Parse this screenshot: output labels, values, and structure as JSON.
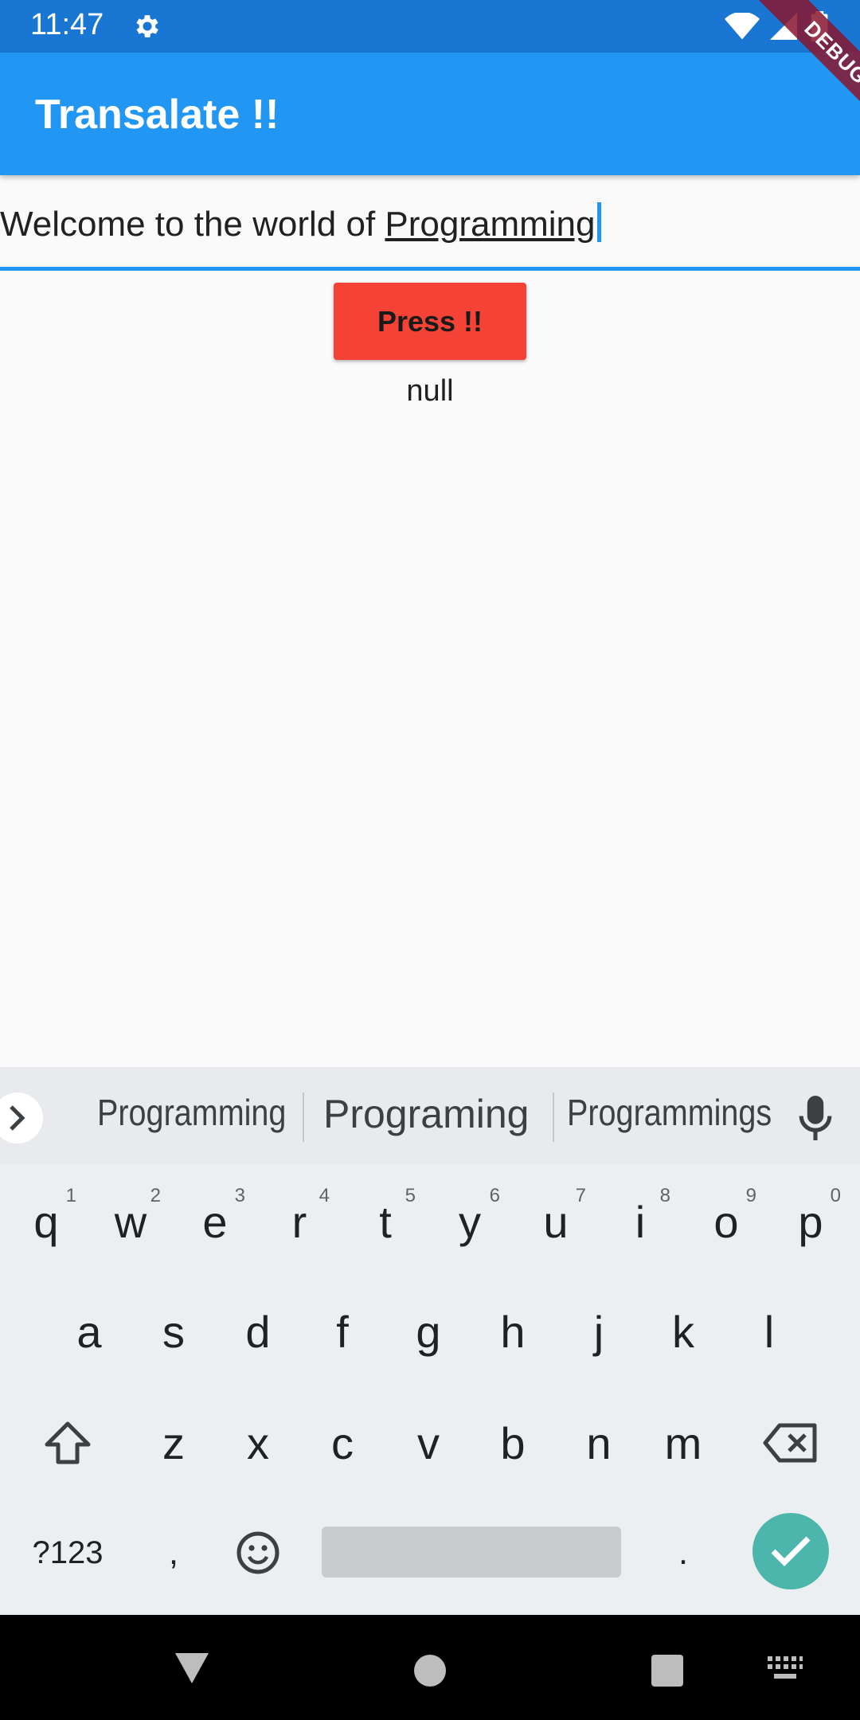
{
  "status_bar": {
    "time": "11:47"
  },
  "debug_banner": "DEBUG",
  "app_bar": {
    "title": "Transalate !!"
  },
  "text_field": {
    "value_prefix": "Welcome to the world of ",
    "value_word": "Programming"
  },
  "button": {
    "label": "Press !!",
    "color": "#f44336"
  },
  "result": "null",
  "keyboard": {
    "suggestions": [
      "Programming",
      "Programing",
      "Programmings"
    ],
    "row1": [
      {
        "k": "q",
        "h": "1"
      },
      {
        "k": "w",
        "h": "2"
      },
      {
        "k": "e",
        "h": "3"
      },
      {
        "k": "r",
        "h": "4"
      },
      {
        "k": "t",
        "h": "5"
      },
      {
        "k": "y",
        "h": "6"
      },
      {
        "k": "u",
        "h": "7"
      },
      {
        "k": "i",
        "h": "8"
      },
      {
        "k": "o",
        "h": "9"
      },
      {
        "k": "p",
        "h": "0"
      }
    ],
    "row2": [
      "a",
      "s",
      "d",
      "f",
      "g",
      "h",
      "j",
      "k",
      "l"
    ],
    "row3": [
      "z",
      "x",
      "c",
      "v",
      "b",
      "n",
      "m"
    ],
    "symbols_label": "?123",
    "comma": ",",
    "period": "."
  },
  "colors": {
    "app_bar": "#2196f3",
    "status_bar": "#1976d2",
    "accent": "#2196f3",
    "enter": "#4db6ac"
  }
}
